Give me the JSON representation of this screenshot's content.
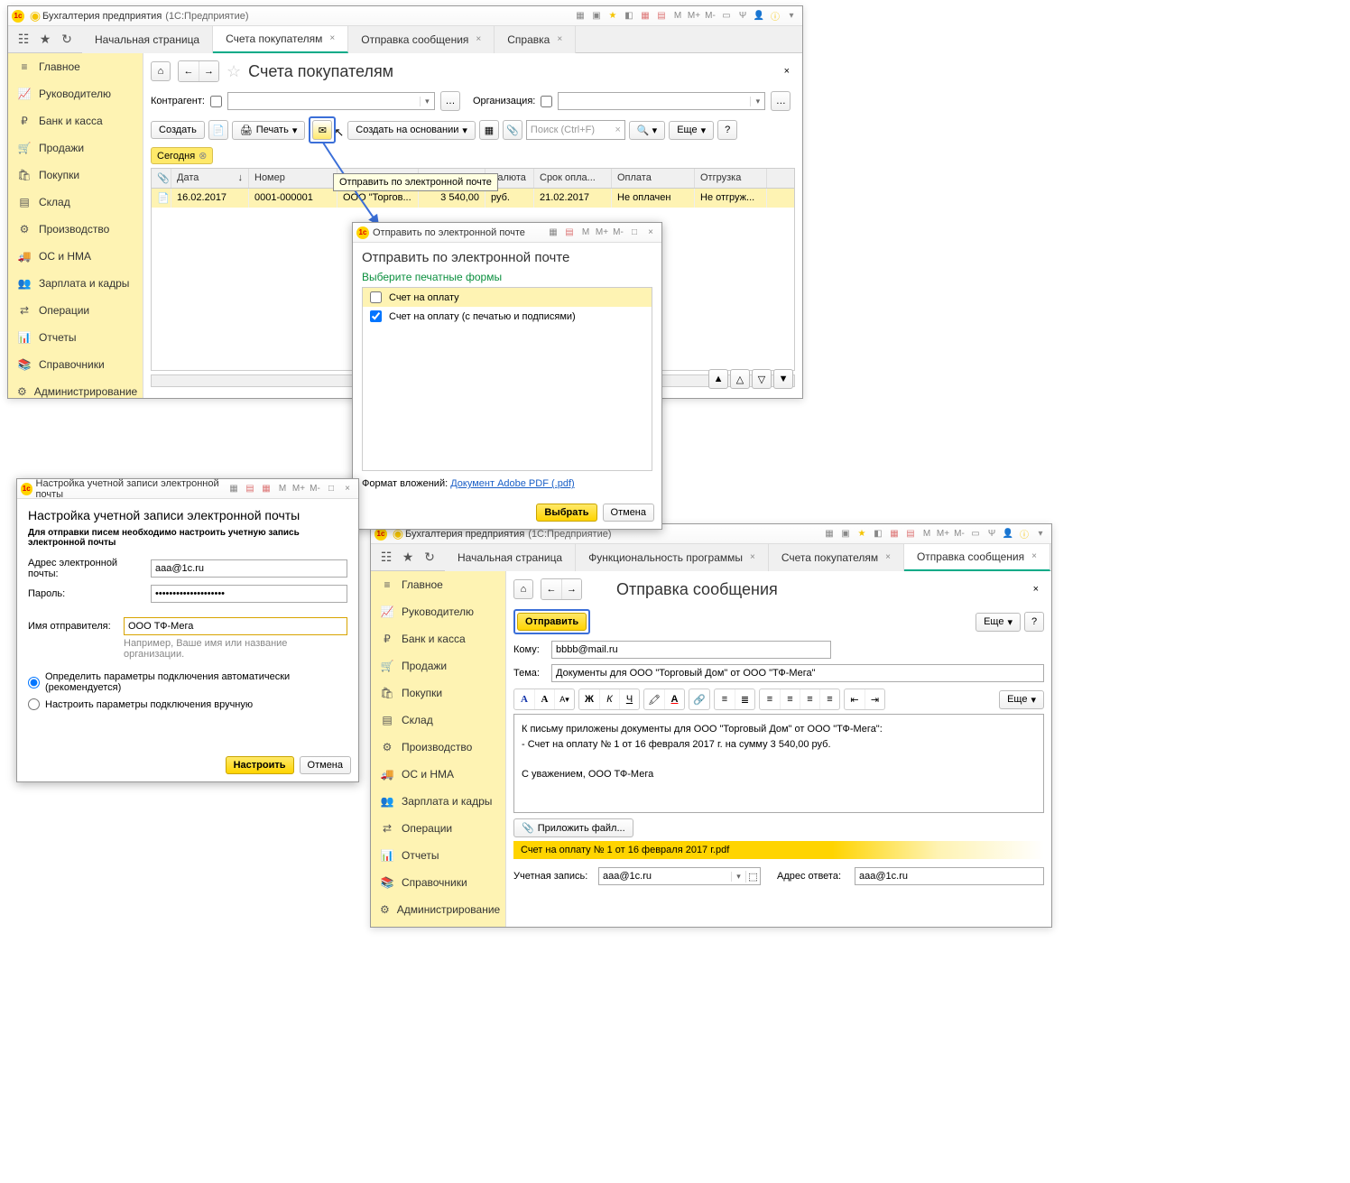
{
  "w1": {
    "title_app": "Бухгалтерия предприятия",
    "title_mode": "(1С:Предприятие)",
    "tabs_fixed": "Начальная страница",
    "tabs": [
      {
        "label": "Счета покупателям",
        "active": true
      },
      {
        "label": "Отправка сообщения",
        "active": false
      },
      {
        "label": "Справка",
        "active": false
      }
    ],
    "sidebar": [
      "Главное",
      "Руководителю",
      "Банк и касса",
      "Продажи",
      "Покупки",
      "Склад",
      "Производство",
      "ОС и НМА",
      "Зарплата и кадры",
      "Операции",
      "Отчеты",
      "Справочники",
      "Администрирование"
    ],
    "page": {
      "title": "Счета покупателям",
      "lbl_counterparty": "Контрагент:",
      "lbl_org": "Организация:",
      "btn_create": "Создать",
      "btn_print": "Печать",
      "btn_create_based": "Создать на основании",
      "search_ph": "Поиск (Ctrl+F)",
      "btn_more": "Еще",
      "tag_today": "Сегодня",
      "tooltip_email": "Отправить по электронной почте",
      "cols": [
        "",
        "Дата",
        "Номер",
        "Контрагент",
        "Сумма",
        "Валюта",
        "Срок опла...",
        "Оплата",
        "Отгрузка"
      ],
      "row": {
        "date": "16.02.2017",
        "num": "0001-000001",
        "cp": "ООО \"Торгов...",
        "sum": "3 540,00",
        "cur": "руб.",
        "due": "21.02.2017",
        "pay": "Не оплачен",
        "ship": "Не отгруж..."
      }
    }
  },
  "modal_email": {
    "tb": "Отправить по электронной почте",
    "title": "Отправить по электронной почте",
    "subtitle": "Выберите печатные формы",
    "forms": [
      {
        "label": "Счет на оплату",
        "checked": false,
        "sel": true
      },
      {
        "label": "Счет на оплату (с печатью и подписями)",
        "checked": true,
        "sel": false
      }
    ],
    "fmt_lbl": "Формат вложений:",
    "fmt_link": "Документ Adobe PDF (.pdf)",
    "btn_select": "Выбрать",
    "btn_cancel": "Отмена"
  },
  "modal_acct": {
    "tb": "Настройка учетной записи электронной почты",
    "title": "Настройка учетной записи электронной почты",
    "hint": "Для отправки писем необходимо настроить учетную запись электронной почты",
    "lbl_addr": "Адрес электронной почты:",
    "val_addr": "aaa@1c.ru",
    "lbl_pwd": "Пароль:",
    "val_pwd": "********************",
    "lbl_sender": "Имя отправителя:",
    "val_sender": "ООО ТФ-Мега",
    "hint_sender": "Например, Ваше имя или название организации.",
    "radio1": "Определить параметры подключения автоматически (рекомендуется)",
    "radio2": "Настроить параметры подключения вручную",
    "btn_ok": "Настроить",
    "btn_cancel": "Отмена"
  },
  "w2": {
    "title_app": "Бухгалтерия предприятия",
    "title_mode": "(1С:Предприятие)",
    "tabs": [
      {
        "label": "Начальная страница"
      },
      {
        "label": "Функциональность программы"
      },
      {
        "label": "Счета покупателям"
      },
      {
        "label": "Отправка сообщения",
        "active": true
      }
    ],
    "sidebar": [
      "Главное",
      "Руководителю",
      "Банк и касса",
      "Продажи",
      "Покупки",
      "Склад",
      "Производство",
      "ОС и НМА",
      "Зарплата и кадры",
      "Операции",
      "Отчеты",
      "Справочники",
      "Администрирование"
    ],
    "page": {
      "title": "Отправка сообщения",
      "btn_send": "Отправить",
      "btn_more": "Еще",
      "lbl_to": "Кому:",
      "val_to": "bbbb@mail.ru",
      "lbl_subj": "Тема:",
      "val_subj": "Документы для ООО \"Торговый Дом\" от ООО \"ТФ-Мега\"",
      "body_l1": "К письму приложены документы для ООО \"Торговый Дом\" от ООО \"ТФ-Мега\":",
      "body_l2": "- Счет на оплату № 1 от 16 февраля 2017 г. на сумму 3 540,00 руб.",
      "body_l3": "С уважением, ООО ТФ-Мега",
      "btn_attach": "Приложить файл...",
      "attachment": "Счет на оплату № 1 от 16 февраля 2017 г.pdf",
      "lbl_account": "Учетная запись:",
      "val_account": "aaa@1c.ru",
      "lbl_reply": "Адрес ответа:",
      "val_reply": "aaa@1c.ru",
      "rte_more": "Еще"
    }
  }
}
